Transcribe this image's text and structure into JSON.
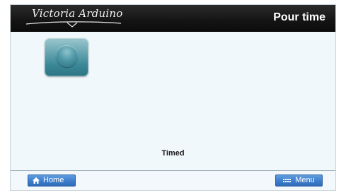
{
  "header": {
    "brand": "Victoria Arduino",
    "title": "Pour time"
  },
  "main": {
    "mode_button_icon": "round-disc-icon",
    "mode_label": "Timed"
  },
  "footer": {
    "home_label": "Home",
    "home_icon": "house-icon",
    "menu_label": "Menu",
    "menu_icon": "grid-dots-icon"
  },
  "colors": {
    "header_bg": "#141414",
    "content_bg": "#f1f8fc",
    "button_blue": "#3d7dcc",
    "icon_teal": "#3b8898"
  }
}
